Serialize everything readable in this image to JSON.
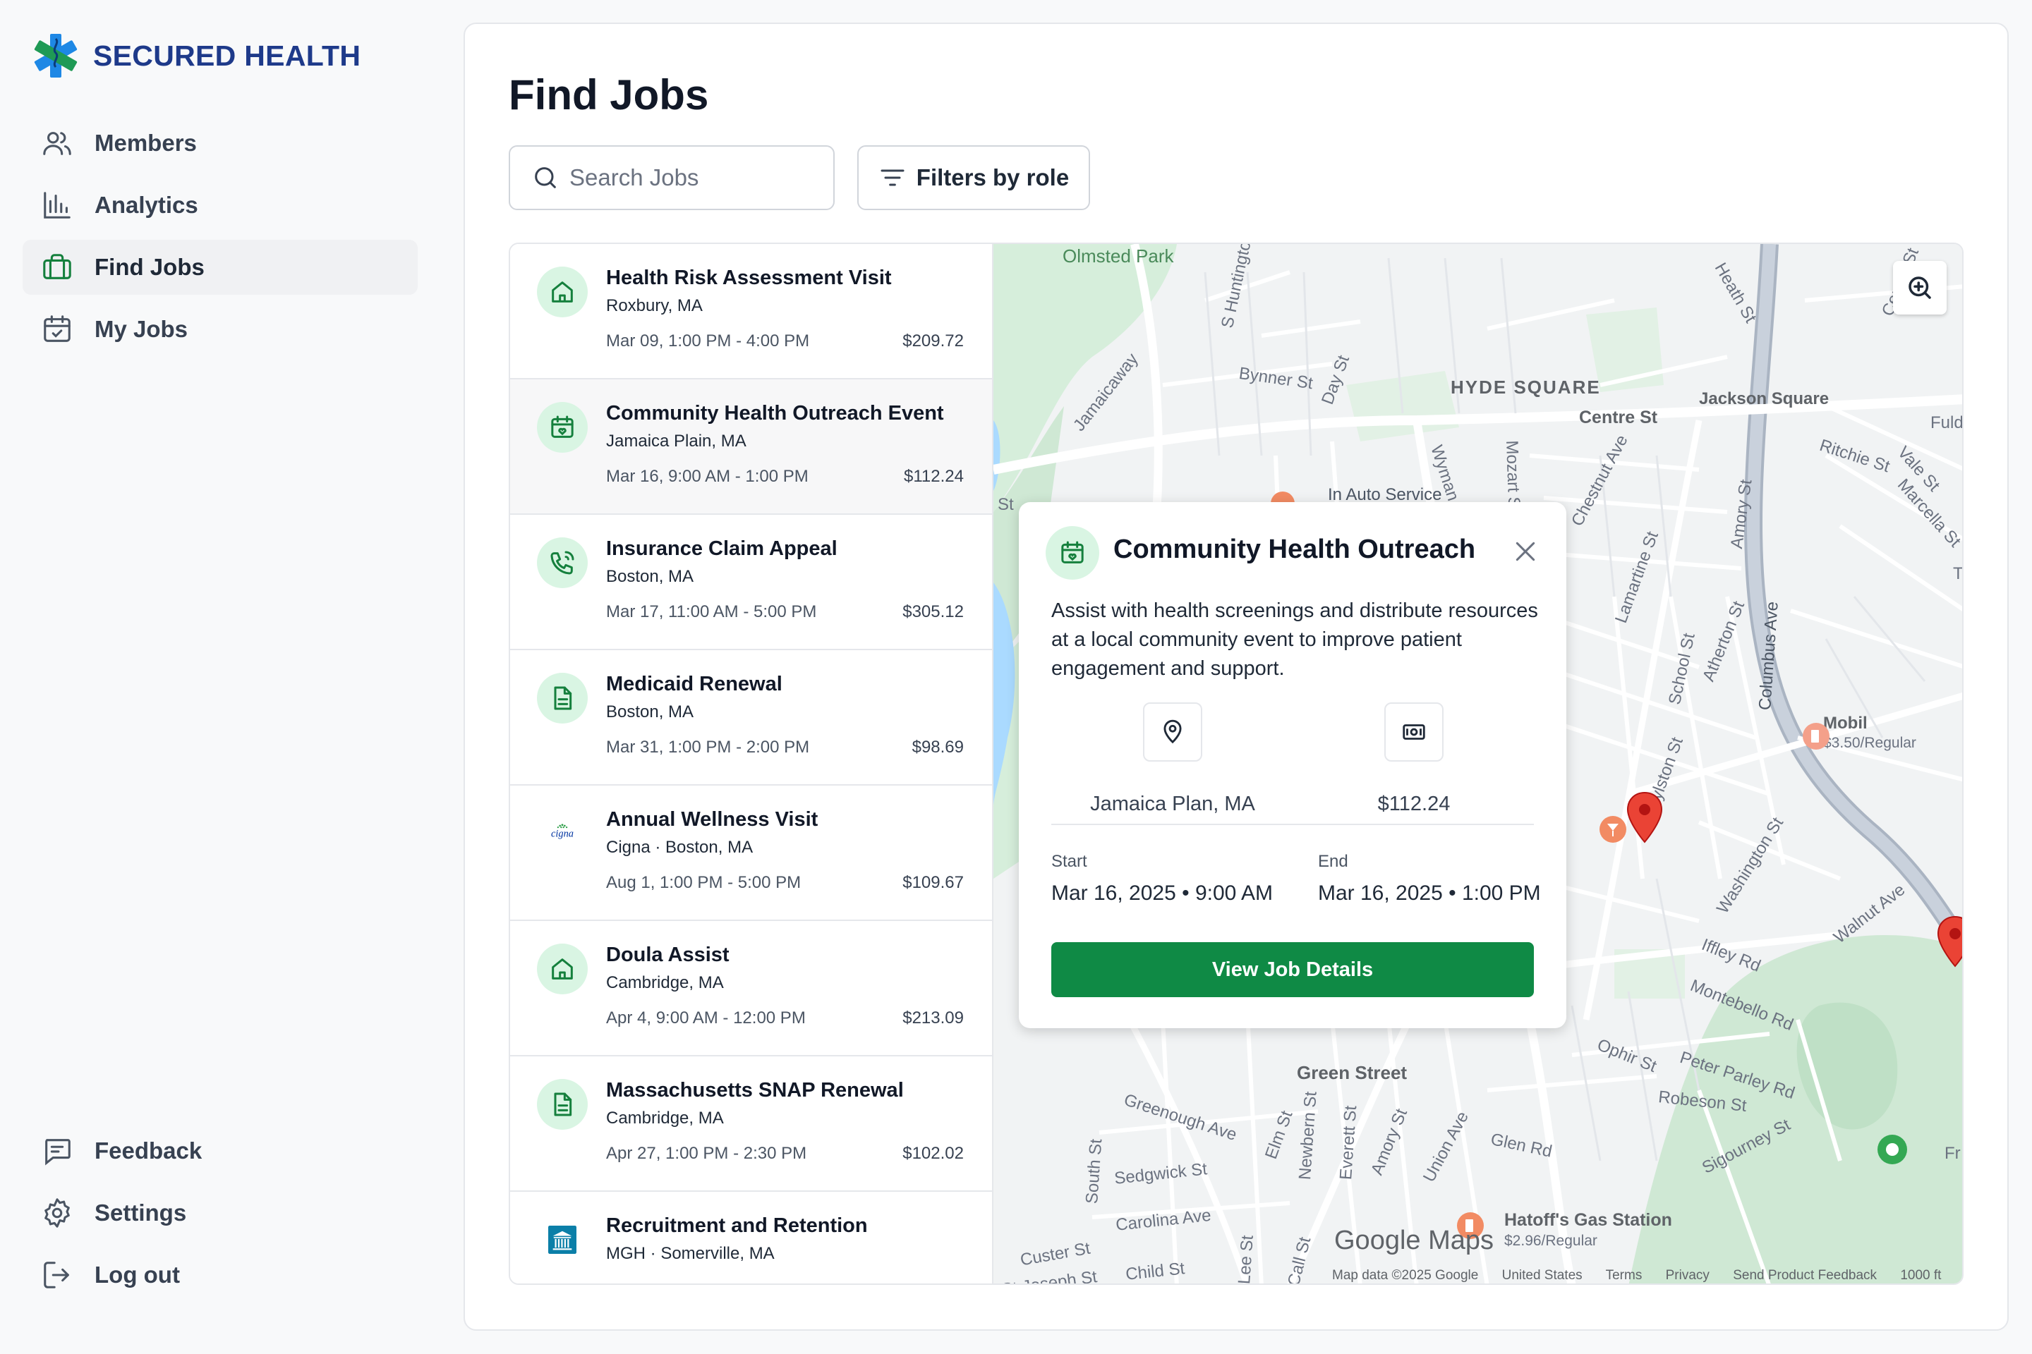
{
  "brand": {
    "name": "SECURED HEALTH"
  },
  "nav": {
    "items": [
      {
        "label": "Members",
        "icon": "users-icon"
      },
      {
        "label": "Analytics",
        "icon": "bar-chart-icon"
      },
      {
        "label": "Find Jobs",
        "icon": "briefcase-icon",
        "active": true
      },
      {
        "label": "My Jobs",
        "icon": "calendar-check-icon"
      }
    ],
    "bottom": [
      {
        "label": "Feedback",
        "icon": "message-icon"
      },
      {
        "label": "Settings",
        "icon": "gear-icon"
      },
      {
        "label": "Log out",
        "icon": "logout-icon"
      }
    ]
  },
  "page": {
    "title": "Find Jobs",
    "search_placeholder": "Search Jobs",
    "filter_label": "Filters by role"
  },
  "jobs": [
    {
      "title": "Health Risk Assessment Visit",
      "location": "Roxbury, MA",
      "time": "Mar 09, 1:00 PM - 4:00 PM",
      "pay": "$209.72",
      "icon": "home-icon"
    },
    {
      "title": "Community Health Outreach Event",
      "location": "Jamaica Plain, MA",
      "time": "Mar 16, 9:00 AM - 1:00 PM",
      "pay": "$112.24",
      "icon": "calendar-heart-icon",
      "selected": true
    },
    {
      "title": "Insurance Claim Appeal",
      "location": "Boston, MA",
      "time": "Mar 17, 11:00 AM - 5:00 PM",
      "pay": "$305.12",
      "icon": "phone-icon"
    },
    {
      "title": "Medicaid Renewal",
      "location": "Boston, MA",
      "time": "Mar 31, 1:00 PM - 2:00 PM",
      "pay": "$98.69",
      "icon": "document-icon"
    },
    {
      "title": "Annual Wellness Visit",
      "location": "Cigna · Boston, MA",
      "time": "Aug 1, 1:00 PM - 5:00 PM",
      "pay": "$109.67",
      "icon": "cigna-logo",
      "logo_text": "cigna"
    },
    {
      "title": "Doula Assist",
      "location": "Cambridge, MA",
      "time": "Apr 4, 9:00 AM - 12:00 PM",
      "pay": "$213.09",
      "icon": "home-icon"
    },
    {
      "title": "Massachusetts SNAP Renewal",
      "location": "Cambridge, MA",
      "time": "Apr 27, 1:00 PM - 2:30 PM",
      "pay": "$102.02",
      "icon": "document-icon"
    },
    {
      "title": "Recruitment and Retention",
      "location": "MGH · Somerville, MA",
      "time": "",
      "pay": "",
      "icon": "mgh-logo"
    }
  ],
  "map": {
    "labels": {
      "olmsted": "Olmsted Park",
      "hyde": "HYDE SQUARE",
      "jackson": "Jackson Square",
      "centre": "Centre St",
      "bynner": "Bynner St",
      "day": "Day St",
      "hunting": "S Huntington",
      "jamaicaway": "Jamaicaway",
      "auto": "In Auto Service",
      "wyman": "Wyman St",
      "mozart": "Mozart St",
      "chestnut": "Chestnut Ave",
      "amory": "Amory St",
      "columbus": "Columbus Ave",
      "ritchie": "Ritchie St",
      "vale": "Vale St",
      "marcella": "Marcella St",
      "heath": "Heath St",
      "centrest": "Centre St",
      "fuld": "Fuld",
      "lamartine": "Lamartine St",
      "school": "School St",
      "atherton": "Atherton St",
      "boylston": "Boylston St",
      "washington": "Washington St",
      "mobil": "Mobil",
      "mobil_price": "$3.50/Regular",
      "walnut": "Walnut Ave",
      "iffley": "Iffley Rd",
      "montebello": "Montebello Rd",
      "ophir": "Ophir St",
      "peter": "Peter Parley Rd",
      "robeson": "Robeson St",
      "green": "Green Street",
      "greenough": "Greenough Ave",
      "elm": "Elm St",
      "newbern": "Newbern St",
      "everett": "Everett St",
      "amory2": "Amory St",
      "union": "Union Ave",
      "glen": "Glen Rd",
      "sigourney": "Sigourney St",
      "south": "South St",
      "sedgwick": "Sedgwick St",
      "carolina": "Carolina Ave",
      "custer": "Custer St",
      "child": "Child St",
      "lee": "Lee St",
      "call": "Call St",
      "hatoff": "Hatoff's Gas Station",
      "hatoff_price": "$2.96/Regular",
      "fr": "Fr",
      "st": "St",
      "t": "T",
      "joseph": "St Joseph St"
    },
    "google": "Google Maps",
    "footer": [
      "Map data ©2025 Google",
      "United States",
      "Terms",
      "Privacy",
      "Send Product Feedback",
      "1000 ft"
    ]
  },
  "popup": {
    "title": "Community Health Outreach",
    "description": "Assist with health screenings and distribute resources at a local community event to improve patient engagement and support.",
    "location": "Jamaica Plan, MA",
    "pay": "$112.24",
    "start_label": "Start",
    "start_value": "Mar 16, 2025 • 9:00 AM",
    "end_label": "End",
    "end_value": "Mar 16, 2025 • 1:00 PM",
    "button": "View Job Details"
  },
  "colors": {
    "brand_blue": "#1e3a8a",
    "accent_green": "#0f8a45",
    "icon_bg": "#d9f5e3",
    "pin_red": "#d93025"
  }
}
